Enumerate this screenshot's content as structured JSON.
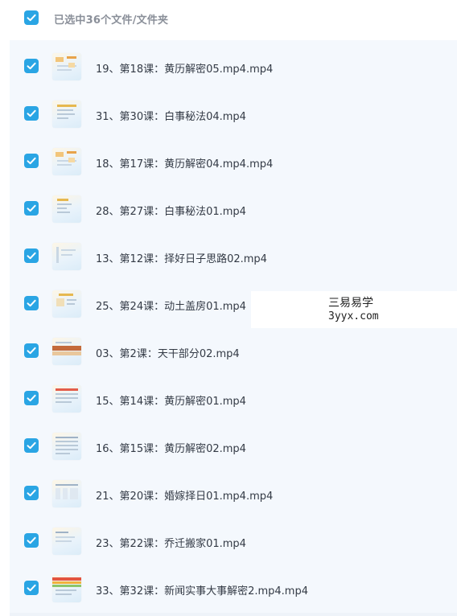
{
  "header": {
    "title": "已选中36个文件/文件夹"
  },
  "files": [
    {
      "name": "19、第18课：黄历解密05.mp4.mp4"
    },
    {
      "name": "31、第30课：白事秘法04.mp4"
    },
    {
      "name": "18、第17课：黄历解密04.mp4.mp4"
    },
    {
      "name": "28、第27课：白事秘法01.mp4"
    },
    {
      "name": "13、第12课：择好日子思路02.mp4"
    },
    {
      "name": "25、第24课：动土盖房01.mp4"
    },
    {
      "name": "03、第2课：天干部分02.mp4"
    },
    {
      "name": "15、第14课：黄历解密01.mp4"
    },
    {
      "name": "16、第15课：黄历解密02.mp4"
    },
    {
      "name": "21、第20课：婚嫁择日01.mp4.mp4"
    },
    {
      "name": "23、第22课：乔迁搬家01.mp4"
    },
    {
      "name": "33、第32课：新闻实事大事解密2.mp4.mp4"
    }
  ],
  "watermark": {
    "line1": "三易易学",
    "line2": "3yyx.com"
  },
  "colors": {
    "checkbox": "#2aa5e4",
    "list_bg": "#f4f8fd"
  }
}
